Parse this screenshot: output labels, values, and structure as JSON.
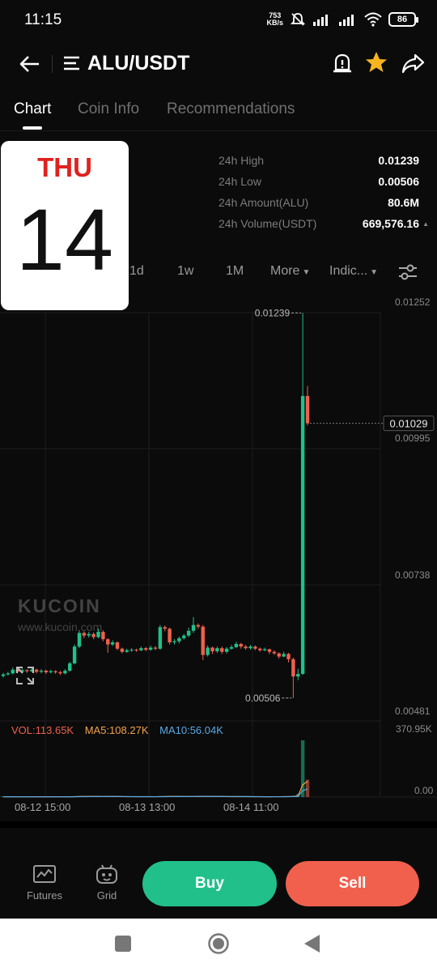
{
  "status_bar": {
    "time": "11:15",
    "net_speed_value": "753",
    "net_speed_unit": "KB/s",
    "battery": "86"
  },
  "header": {
    "pair": "ALU/USDT"
  },
  "tabs": [
    {
      "label": "Chart",
      "active": true
    },
    {
      "label": "Coin Info",
      "active": false
    },
    {
      "label": "Recommendations",
      "active": false
    }
  ],
  "stats": [
    {
      "label": "24h High",
      "value": "0.01239"
    },
    {
      "label": "24h Low",
      "value": "0.00506"
    },
    {
      "label": "24h Amount(ALU)",
      "value": "80.6M"
    },
    {
      "label": "24h Volume(USDT)",
      "value": "669,576.16"
    }
  ],
  "calendar_widget": {
    "day": "THU",
    "date": "14"
  },
  "timeframes": {
    "d1": "1d",
    "w1": "1w",
    "m1": "1M",
    "more": "More",
    "indicators": "Indic..."
  },
  "chart_data": {
    "type": "candlestick",
    "price_axis_labels": [
      "0.01252",
      "0.00995",
      "0.00738",
      "0.00481"
    ],
    "high_marker": "0.01239",
    "low_marker": "0.00506",
    "last_price": "0.01029",
    "volume_axis_labels": [
      "370.95K",
      "0.00"
    ],
    "x_labels": [
      "08-12 15:00",
      "08-13 13:00",
      "08-14 11:00"
    ],
    "ylim": [
      0.00481,
      0.01252
    ],
    "candles": [
      [
        0.00548,
        0.00551,
        0.00554,
        0.00545
      ],
      [
        0.00551,
        0.00553,
        0.00556,
        0.00549
      ],
      [
        0.00553,
        0.0056,
        0.00564,
        0.00551
      ],
      [
        0.0056,
        0.00556,
        0.00562,
        0.00553
      ],
      [
        0.00556,
        0.00559,
        0.00562,
        0.00554
      ],
      [
        0.00559,
        0.00557,
        0.00561,
        0.00554
      ],
      [
        0.00557,
        0.0056,
        0.00563,
        0.00555
      ],
      [
        0.0056,
        0.00556,
        0.00562,
        0.00553
      ],
      [
        0.00556,
        0.00558,
        0.00561,
        0.00553
      ],
      [
        0.00558,
        0.00555,
        0.0056,
        0.00552
      ],
      [
        0.00555,
        0.00557,
        0.0056,
        0.00553
      ],
      [
        0.00557,
        0.00555,
        0.00559,
        0.00552
      ],
      [
        0.00555,
        0.00553,
        0.00558,
        0.0055
      ],
      [
        0.00553,
        0.00558,
        0.00561,
        0.00551
      ],
      [
        0.00558,
        0.00572,
        0.00575,
        0.00556
      ],
      [
        0.00572,
        0.00604,
        0.00608,
        0.0057
      ],
      [
        0.00604,
        0.0063,
        0.00634,
        0.00601
      ],
      [
        0.0063,
        0.00625,
        0.00633,
        0.0062
      ],
      [
        0.00625,
        0.00628,
        0.00632,
        0.00621
      ],
      [
        0.00628,
        0.00622,
        0.00631,
        0.00618
      ],
      [
        0.00622,
        0.00632,
        0.00638,
        0.0062
      ],
      [
        0.00632,
        0.00618,
        0.00635,
        0.00614
      ],
      [
        0.00618,
        0.00608,
        0.0062,
        0.00592
      ],
      [
        0.00608,
        0.00612,
        0.00616,
        0.00605
      ],
      [
        0.00612,
        0.006,
        0.00614,
        0.00597
      ],
      [
        0.006,
        0.00594,
        0.00602,
        0.00591
      ],
      [
        0.00594,
        0.00597,
        0.006,
        0.00592
      ],
      [
        0.00597,
        0.00598,
        0.00601,
        0.00594
      ],
      [
        0.00598,
        0.00597,
        0.006,
        0.00594
      ],
      [
        0.00597,
        0.00601,
        0.00604,
        0.00595
      ],
      [
        0.00601,
        0.00598,
        0.00603,
        0.00595
      ],
      [
        0.00598,
        0.00602,
        0.00606,
        0.00596
      ],
      [
        0.00602,
        0.006,
        0.00605,
        0.00597
      ],
      [
        0.006,
        0.00641,
        0.00645,
        0.00598
      ],
      [
        0.00641,
        0.00638,
        0.00644,
        0.00633
      ],
      [
        0.00638,
        0.00612,
        0.0064,
        0.00608
      ],
      [
        0.00612,
        0.00614,
        0.00618,
        0.00608
      ],
      [
        0.00614,
        0.0062,
        0.00623,
        0.0061
      ],
      [
        0.0062,
        0.00625,
        0.00628,
        0.00617
      ],
      [
        0.00625,
        0.00634,
        0.0064,
        0.00622
      ],
      [
        0.00634,
        0.00645,
        0.0066,
        0.0063
      ],
      [
        0.00645,
        0.00642,
        0.00648,
        0.00638
      ],
      [
        0.00642,
        0.00588,
        0.00645,
        0.00578
      ],
      [
        0.00588,
        0.00602,
        0.00606,
        0.00585
      ],
      [
        0.00602,
        0.00595,
        0.00604,
        0.0059
      ],
      [
        0.00595,
        0.00601,
        0.00604,
        0.00592
      ],
      [
        0.00601,
        0.00594,
        0.00604,
        0.0059
      ],
      [
        0.00594,
        0.006,
        0.00603,
        0.00591
      ],
      [
        0.006,
        0.00603,
        0.00607,
        0.00598
      ],
      [
        0.00603,
        0.00609,
        0.00613,
        0.00601
      ],
      [
        0.00609,
        0.00604,
        0.00611,
        0.006
      ],
      [
        0.00604,
        0.00601,
        0.00607,
        0.00598
      ],
      [
        0.00601,
        0.00604,
        0.00607,
        0.00598
      ],
      [
        0.00604,
        0.006,
        0.00606,
        0.00597
      ],
      [
        0.006,
        0.00597,
        0.00602,
        0.00594
      ],
      [
        0.00597,
        0.00599,
        0.00602,
        0.00595
      ],
      [
        0.00599,
        0.00594,
        0.006,
        0.0059
      ],
      [
        0.00594,
        0.00591,
        0.00597,
        0.00588
      ],
      [
        0.00591,
        0.00585,
        0.00593,
        0.00581
      ],
      [
        0.00585,
        0.0059,
        0.00594,
        0.00584
      ],
      [
        0.0059,
        0.0058,
        0.00592,
        0.00574
      ],
      [
        0.0058,
        0.00547,
        0.00583,
        0.00506
      ],
      [
        0.00547,
        0.00552,
        0.00562,
        0.0054
      ],
      [
        0.00552,
        0.01081,
        0.01239,
        0.0055
      ],
      [
        0.01081,
        0.01029,
        0.011,
        0.01025
      ]
    ],
    "volume_legend": {
      "vol": "VOL:113.65K",
      "ma5": "MA5:108.27K",
      "ma10": "MA10:56.04K"
    },
    "volume_max": 370.95,
    "volumes": [
      2,
      2,
      2,
      1,
      2,
      2,
      1,
      2,
      2,
      1,
      2,
      2,
      1,
      2,
      3,
      5,
      6,
      4,
      3,
      3,
      4,
      3,
      4,
      3,
      3,
      2,
      2,
      2,
      2,
      3,
      2,
      2,
      2,
      6,
      4,
      5,
      3,
      3,
      3,
      4,
      5,
      4,
      6,
      4,
      3,
      3,
      3,
      2,
      3,
      3,
      3,
      2,
      2,
      2,
      2,
      2,
      2,
      3,
      3,
      3,
      4,
      6,
      20,
      370.95,
      113.65
    ]
  },
  "watermark": {
    "brand": "KUCOIN",
    "url": "www.kucoin.com"
  },
  "bottom_nav": {
    "futures": "Futures",
    "grid": "Grid",
    "buy": "Buy",
    "sell": "Sell"
  },
  "colors": {
    "up": "#21c08a",
    "down": "#f0604d",
    "star": "#f6b51e"
  }
}
